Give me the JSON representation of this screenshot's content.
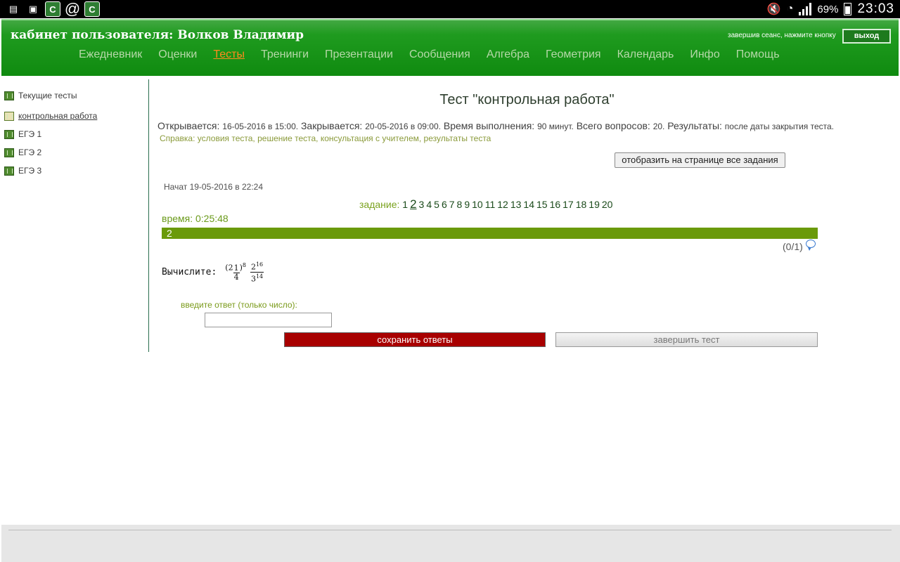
{
  "status_bar": {
    "battery": "69%",
    "time": "23:03"
  },
  "header": {
    "title": "кабинет пользователя: Волков Владимир",
    "logout_hint": "завершив сеанс, нажмите кнопку",
    "logout_label": "выход",
    "nav": [
      "Ежедневник",
      "Оценки",
      "Тесты",
      "Тренинги",
      "Презентации",
      "Сообщения",
      "Алгебра",
      "Геометрия",
      "Календарь",
      "Инфо",
      "Помощь"
    ],
    "active_nav": "Тесты",
    "colors": {
      "header_green": "#1f9b1f",
      "nav_text": "#b5d8a8",
      "active_nav": "#ff8a1e"
    }
  },
  "sidebar": {
    "items": [
      {
        "label": "Текущие тесты",
        "icon": "book-icon"
      },
      {
        "label": "контрольная работа",
        "icon": "open-book-icon"
      },
      {
        "label": "ЕГЭ 1",
        "icon": "book-icon"
      },
      {
        "label": "ЕГЭ 2",
        "icon": "book-icon"
      },
      {
        "label": "ЕГЭ 3",
        "icon": "book-icon"
      }
    ]
  },
  "test": {
    "title": "Тест \"контрольная работа\"",
    "opens_label": "Открывается:",
    "opens_value": "16-05-2016 в 15:00.",
    "closes_label": "Закрывается:",
    "closes_value": "20-05-2016 в 09:00.",
    "duration_label": "Время выполнения:",
    "duration_value": "90 минут.",
    "questions_label": "Всего вопросов:",
    "questions_value": "20.",
    "results_label": "Результаты:",
    "results_value": "после даты закрытия теста.",
    "help_label": "Справка:",
    "help_links": [
      "условия теста",
      "решение теста",
      "консультация с учителем",
      "результаты теста"
    ],
    "show_all_label": "отобразить на странице все задания",
    "started": "Начат 19-05-2016 в 22:24",
    "tasks_label": "задание:",
    "task_numbers": [
      "1",
      "2",
      "3",
      "4",
      "5",
      "6",
      "7",
      "8",
      "9",
      "10",
      "11",
      "12",
      "13",
      "14",
      "15",
      "16",
      "17",
      "18",
      "19",
      "20"
    ],
    "current_task": "2",
    "timer": "время: 0:25:48",
    "question_number": "2",
    "score": "(0/1)",
    "question_text": "Вычислите:",
    "formula": {
      "whole": "2",
      "num": "1",
      "den": "4",
      "power": "8",
      "frac_num_base": "2",
      "frac_num_exp": "16",
      "frac_den_base": "3",
      "frac_den_exp": "14"
    },
    "answer_label": "введите ответ (только число):",
    "answer_value": "",
    "save_label": "сохранить ответы",
    "finish_label": "завершить тест"
  }
}
